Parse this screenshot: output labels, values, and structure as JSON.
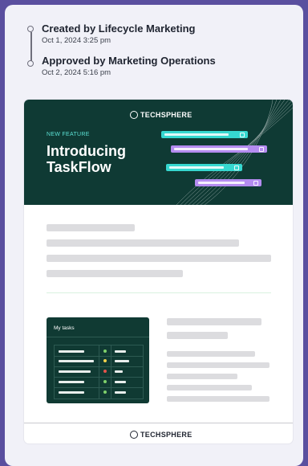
{
  "activity": [
    {
      "title": "Created by Lifecycle Marketing",
      "time": "Oct 1, 2024 3:25 pm"
    },
    {
      "title": "Approved by Marketing Operations",
      "time": "Oct 2, 2024 5:16 pm"
    }
  ],
  "email": {
    "brand": "TECHSPHERE",
    "kicker": "NEW FEATURE",
    "headline_line1": "Introducing",
    "headline_line2": "TaskFlow",
    "tasks_card_title": "My tasks",
    "footer_brand": "TECHSPHERE",
    "task_status_colors": [
      "#7fd16b",
      "#f2d24b",
      "#e5534b",
      "#7fd16b",
      "#7fd16b"
    ]
  },
  "colors": {
    "background": "#5a4f9f",
    "hero": "#0f3a34",
    "accent_teal": "#5ce1d4",
    "accent_purple": "#b48cf0"
  }
}
